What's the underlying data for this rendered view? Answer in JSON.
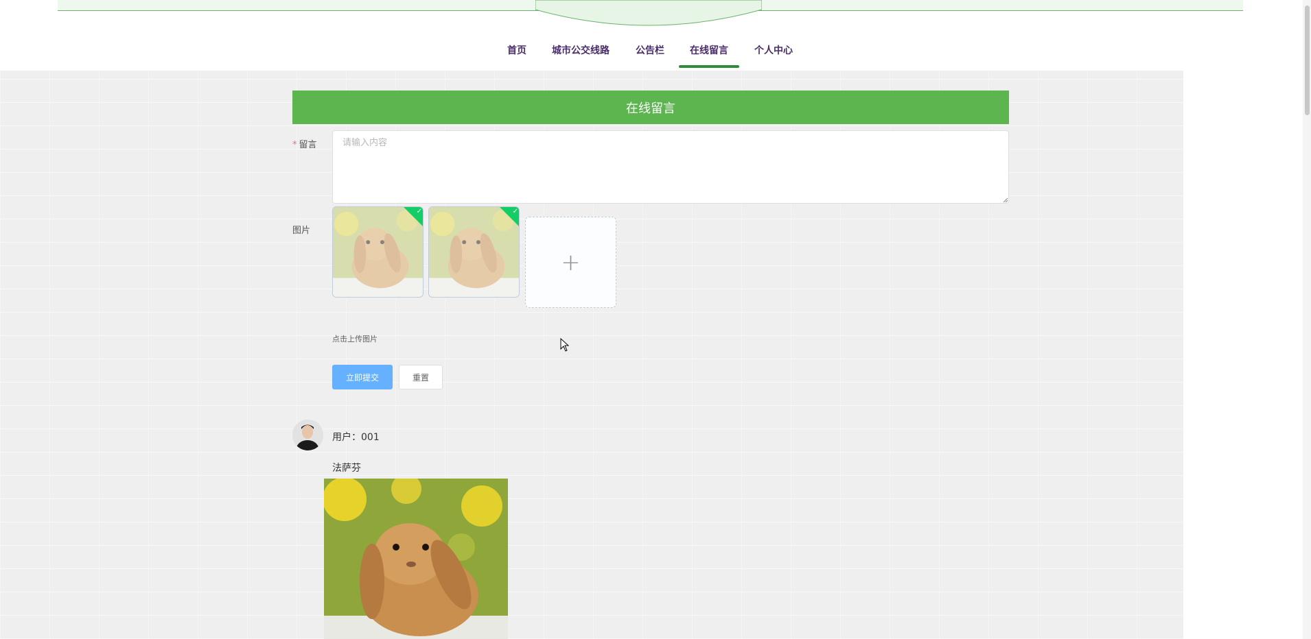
{
  "nav": {
    "items": [
      {
        "label": "首页",
        "active": false
      },
      {
        "label": "城市公交线路",
        "active": false
      },
      {
        "label": "公告栏",
        "active": false
      },
      {
        "label": "在线留言",
        "active": true
      },
      {
        "label": "个人中心",
        "active": false
      }
    ]
  },
  "page_title": "在线留言",
  "form": {
    "message_label": "留言",
    "message_required_mark": "*",
    "message_placeholder": "请输入内容",
    "image_label": "图片",
    "upload_tip": "点击上传图片",
    "upload_plus": "+",
    "uploaded_count": 2,
    "submit_label": "立即提交",
    "reset_label": "重置"
  },
  "comment": {
    "user_text": "用户：001",
    "message": "法萨芬"
  },
  "colors": {
    "title_bar": "#5db550",
    "nav_text": "#4a2c6b",
    "nav_active_underline": "#2e8b3a",
    "primary_button": "#66b1ff",
    "upload_success": "#13ce66"
  }
}
